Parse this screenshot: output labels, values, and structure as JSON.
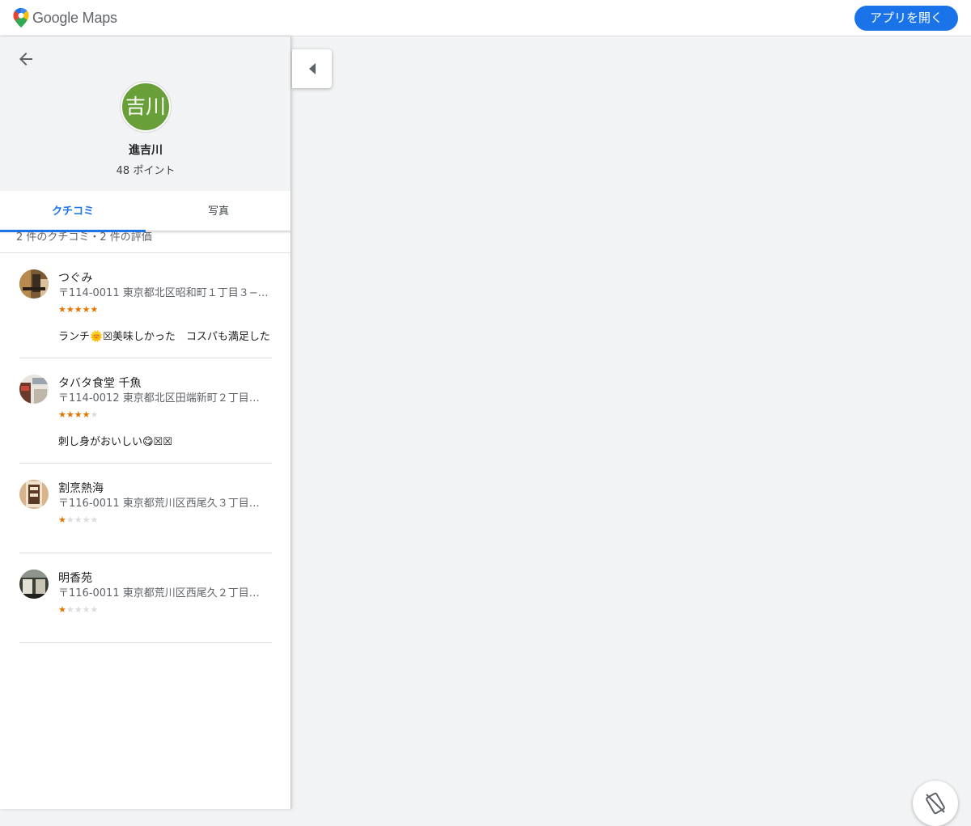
{
  "header": {
    "logo_text": "Google Maps",
    "open_app_label": "アプリを開く",
    "accent_color": "#1a73e8"
  },
  "profile": {
    "avatar_text": "吉川",
    "name": "進吉川",
    "points": "48 ポイント",
    "avatar_color": "#689f38"
  },
  "tabs": [
    {
      "label": "クチコミ",
      "active": true
    },
    {
      "label": "写真",
      "active": false
    }
  ],
  "summary": "2 件のクチコミ・2 件の評価",
  "reviews": [
    {
      "name": "つぐみ",
      "address": "〒114-0011 東京都北区昭和町１丁目３−…",
      "rating": 5,
      "text": "ランチ🌞☒美味しかった　コスパも満足した"
    },
    {
      "name": "タバタ食堂 千魚",
      "address": "〒114-0012 東京都北区田端新町２丁目…",
      "rating": 4,
      "text": "刺し身がおいしい😋☒☒"
    },
    {
      "name": "割烹熱海",
      "address": "〒116-0011 東京都荒川区西尾久３丁目…",
      "rating": 1,
      "text": ""
    },
    {
      "name": "明香苑",
      "address": "〒116-0011 東京都荒川区西尾久２丁目…",
      "rating": 1,
      "text": ""
    }
  ],
  "icons": {
    "back": "arrow-back-icon",
    "collapse": "caret-left-icon",
    "rotate": "rotate-disabled-icon",
    "star": "star-icon"
  }
}
